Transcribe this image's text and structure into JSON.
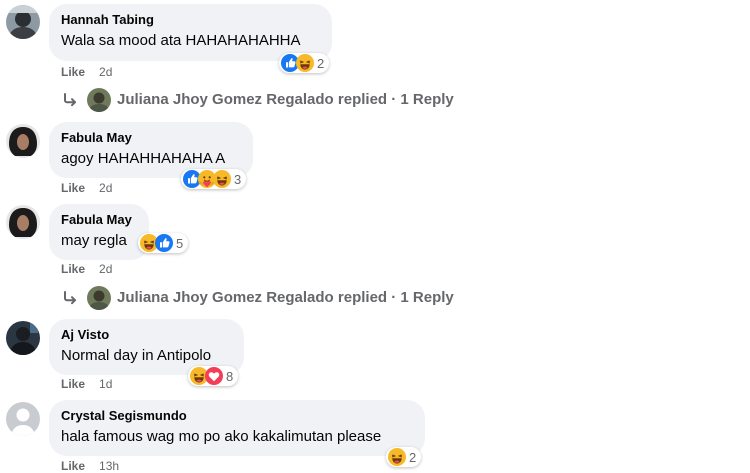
{
  "comments": [
    {
      "author": "Hannah Tabing",
      "text": "Wala sa mood ata HAHAHAHAHHA",
      "like_label": "Like",
      "time": "2d",
      "reaction_count": "2",
      "reactions": [
        "like",
        "haha"
      ]
    },
    {
      "author": "Fabula May",
      "text": "agoy HAHAHHAHAHA A",
      "like_label": "Like",
      "time": "2d",
      "reaction_count": "3",
      "reactions": [
        "like",
        "care",
        "haha"
      ]
    },
    {
      "author": "Fabula May",
      "text": "may regla",
      "like_label": "Like",
      "time": "2d",
      "reaction_count": "5",
      "reactions": [
        "haha",
        "like"
      ]
    },
    {
      "author": "Aj Visto",
      "text": "Normal day in Antipolo",
      "like_label": "Like",
      "time": "1d",
      "reaction_count": "8",
      "reactions": [
        "haha",
        "love"
      ]
    },
    {
      "author": "Crystal Segismundo",
      "text": "hala famous wag mo po ako kakalimutan please",
      "like_label": "Like",
      "time": "13h",
      "reaction_count": "2",
      "reactions": [
        "haha"
      ]
    }
  ],
  "replies": [
    {
      "text": "Juliana Jhoy Gomez Regalado replied · 1 Reply"
    },
    {
      "text": "Juliana Jhoy Gomez Regalado replied · 1 Reply"
    }
  ],
  "colors": {
    "bubble": "#f0f2f5",
    "like_blue": "#1877f2",
    "haha_yellow": "#f7b928",
    "love_red": "#f33e58",
    "meta_gray": "#65676b"
  }
}
